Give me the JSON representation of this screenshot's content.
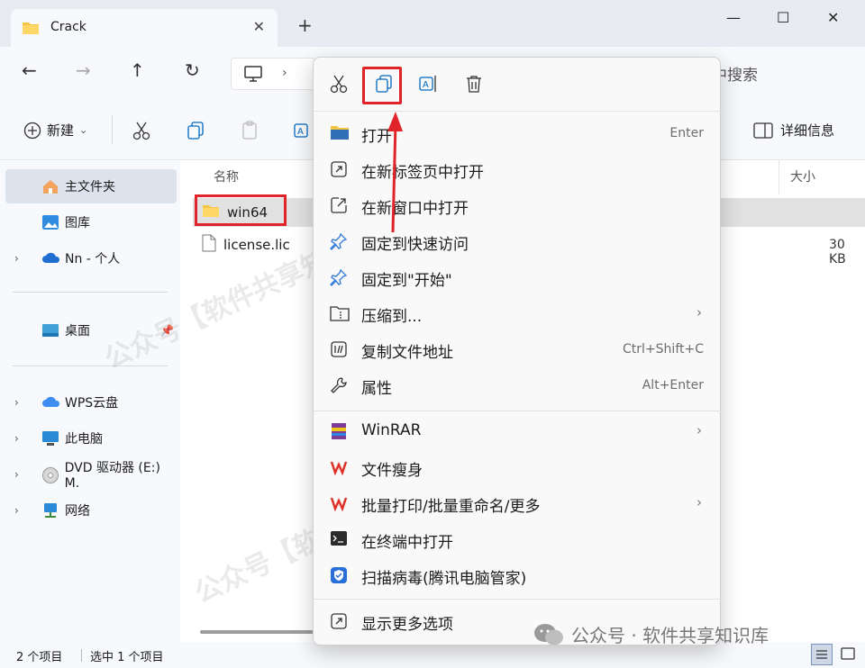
{
  "window": {
    "tab_title": "Crack",
    "new_tab": "+",
    "controls": {
      "minimize": "—",
      "maximize": "☐",
      "close": "✕"
    }
  },
  "address": {
    "search_text": "中搜索"
  },
  "toolbar": {
    "new_label": "新建",
    "details_label": "详细信息"
  },
  "sidebar": {
    "items": [
      {
        "label": "主文件夹",
        "icon": "home-icon"
      },
      {
        "label": "图库",
        "icon": "gallery-icon"
      },
      {
        "label": "Nn - 个人",
        "icon": "onedrive-icon"
      },
      {
        "label": "桌面",
        "icon": "desktop-icon"
      },
      {
        "label": "WPS云盘",
        "icon": "cloud-icon"
      },
      {
        "label": "此电脑",
        "icon": "pc-icon"
      },
      {
        "label": "DVD 驱动器 (E:) M.",
        "icon": "dvd-icon"
      },
      {
        "label": "网络",
        "icon": "network-icon"
      }
    ]
  },
  "files": {
    "col_name": "名称",
    "col_size": "大小",
    "rows": [
      {
        "name": "win64",
        "size": ""
      },
      {
        "name": "license.lic",
        "size": "30 KB"
      }
    ]
  },
  "status": {
    "count": "2 个项目",
    "selected": "选中 1 个项目"
  },
  "context_menu": {
    "items": [
      {
        "label": "打开",
        "shortcut": "Enter"
      },
      {
        "label": "在新标签页中打开",
        "shortcut": ""
      },
      {
        "label": "在新窗口中打开",
        "shortcut": ""
      },
      {
        "label": "固定到快速访问",
        "shortcut": ""
      },
      {
        "label": "固定到\"开始\"",
        "shortcut": ""
      },
      {
        "label": "压缩到...",
        "shortcut": ""
      },
      {
        "label": "复制文件地址",
        "shortcut": "Ctrl+Shift+C"
      },
      {
        "label": "属性",
        "shortcut": "Alt+Enter"
      },
      {
        "label": "WinRAR",
        "shortcut": ""
      },
      {
        "label": "文件瘦身",
        "shortcut": ""
      },
      {
        "label": "批量打印/批量重命名/更多",
        "shortcut": ""
      },
      {
        "label": "在终端中打开",
        "shortcut": ""
      },
      {
        "label": "扫描病毒(腾讯电脑管家)",
        "shortcut": ""
      },
      {
        "label": "显示更多选项",
        "shortcut": ""
      }
    ]
  },
  "watermarks": [
    "公众号【软件共享知识库】",
    "公众号【软件共享知识库】",
    "公众号【软件共享知识库】"
  ],
  "wechat_label": "公众号 · 软件共享知识库",
  "colors": {
    "highlight": "#e0242a",
    "accent": "#0067c0",
    "folder": "#f5c542"
  }
}
